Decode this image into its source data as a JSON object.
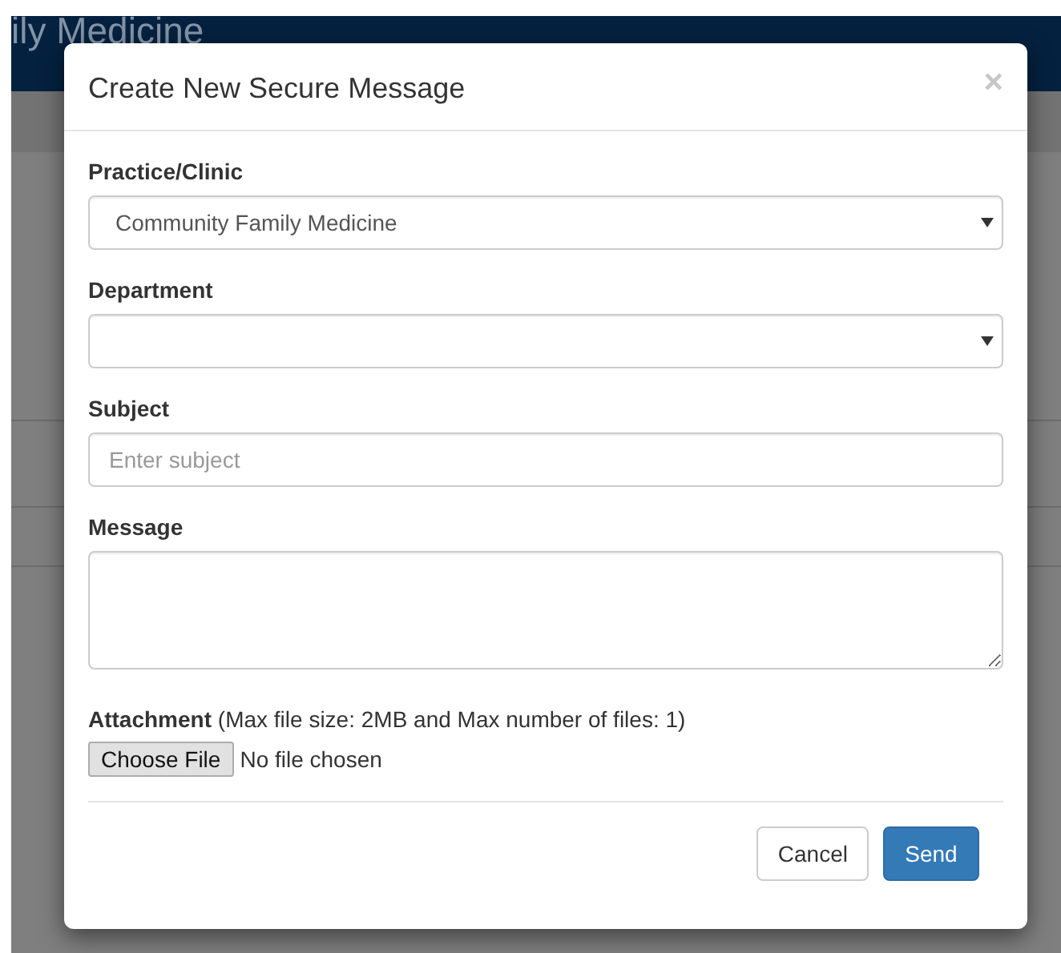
{
  "page": {
    "header_title": "ily Medicine"
  },
  "dialog": {
    "title": "Create New Secure Message",
    "close": "×",
    "fields": [
      {
        "kind": "select",
        "label": "Practice/Clinic",
        "value": "Community Family Medicine"
      },
      {
        "kind": "select",
        "label": "Department"
      },
      {
        "kind": "text",
        "label": "Subject",
        "placeholder": "Enter subject"
      },
      {
        "kind": "textarea",
        "label": "Message"
      }
    ],
    "attachment": {
      "label": "Attachment",
      "note": "(Max file size: 2MB and Max number of files: 1)",
      "button": "Choose File",
      "status": "No file chosen"
    },
    "buttons": [
      {
        "label": "Cancel",
        "kind": "default"
      },
      {
        "label": "Send",
        "kind": "primary"
      }
    ]
  }
}
